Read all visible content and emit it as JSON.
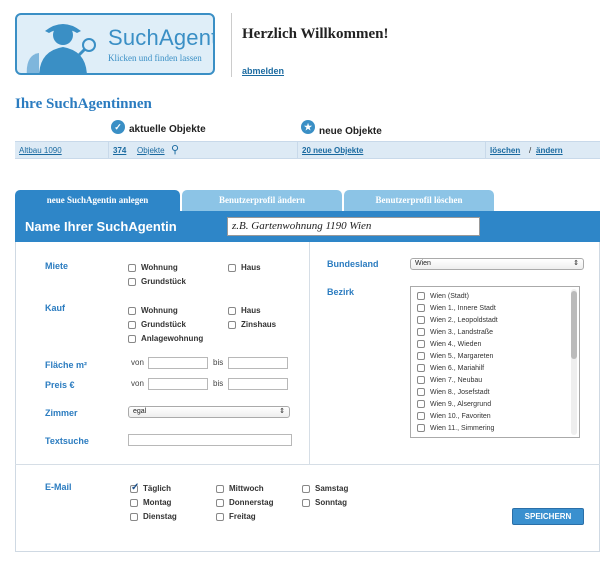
{
  "header": {
    "logo_title": "SuchAgentin",
    "logo_subtitle": "Klicken und finden lassen",
    "welcome": "Herzlich Willkommen!",
    "logout": "abmelden"
  },
  "section_title": "Ihre SuchAgentinnen",
  "objects_header": {
    "current_icon": "check-circle-icon",
    "current_label": "aktuelle Objekte",
    "new_icon": "star-circle-icon",
    "new_label": "neue Objekte"
  },
  "summary_row": {
    "name": "Altbau 1090",
    "count": "374",
    "objects_label": "Objekte",
    "new_objects": "20 neue Objekte",
    "delete": "löschen",
    "separator": "/",
    "edit": "ändern"
  },
  "tabs": [
    {
      "label": "neue SuchAgentin anlegen",
      "active": true
    },
    {
      "label": "Benutzerprofil ändern",
      "active": false
    },
    {
      "label": "Benutzerprofil löschen",
      "active": false
    }
  ],
  "name_section": {
    "label": "Name Ihrer SuchAgentin",
    "placeholder": "z.B. Gartenwohnung 1190 Wien"
  },
  "form": {
    "rent_label": "Miete",
    "rent_options": [
      "Wohnung",
      "Haus",
      "Grundstück"
    ],
    "buy_label": "Kauf",
    "buy_options": [
      "Wohnung",
      "Haus",
      "Grundstück",
      "Zinshaus",
      "Anlagewohnung"
    ],
    "area_label": "Fläche m²",
    "price_label": "Preis €",
    "from": "von",
    "to": "bis",
    "rooms_label": "Zimmer",
    "rooms_value": "egal",
    "text_search_label": "Textsuche",
    "state_label": "Bundesland",
    "state_value": "Wien",
    "district_label": "Bezirk",
    "districts": [
      "Wien (Stadt)",
      "Wien 1., Innere Stadt",
      "Wien 2., Leopoldstadt",
      "Wien 3., Landstraße",
      "Wien 4., Wieden",
      "Wien 5., Margareten",
      "Wien 6., Mariahilf",
      "Wien 7., Neubau",
      "Wien 8., Josefstadt",
      "Wien 9., Alsergrund",
      "Wien 10., Favoriten",
      "Wien 11., Simmering"
    ]
  },
  "email": {
    "label": "E-Mail",
    "days": [
      {
        "label": "Täglich",
        "checked": true
      },
      {
        "label": "Montag",
        "checked": false
      },
      {
        "label": "Dienstag",
        "checked": false
      },
      {
        "label": "Mittwoch",
        "checked": false
      },
      {
        "label": "Donnerstag",
        "checked": false
      },
      {
        "label": "Freitag",
        "checked": false
      },
      {
        "label": "Samstag",
        "checked": false
      },
      {
        "label": "Sonntag",
        "checked": false
      }
    ],
    "save": "SPEICHERN"
  },
  "colors": {
    "accent": "#2e86c8",
    "tab_inactive": "#8cc4e6",
    "row_bg": "#ddeaf5"
  }
}
